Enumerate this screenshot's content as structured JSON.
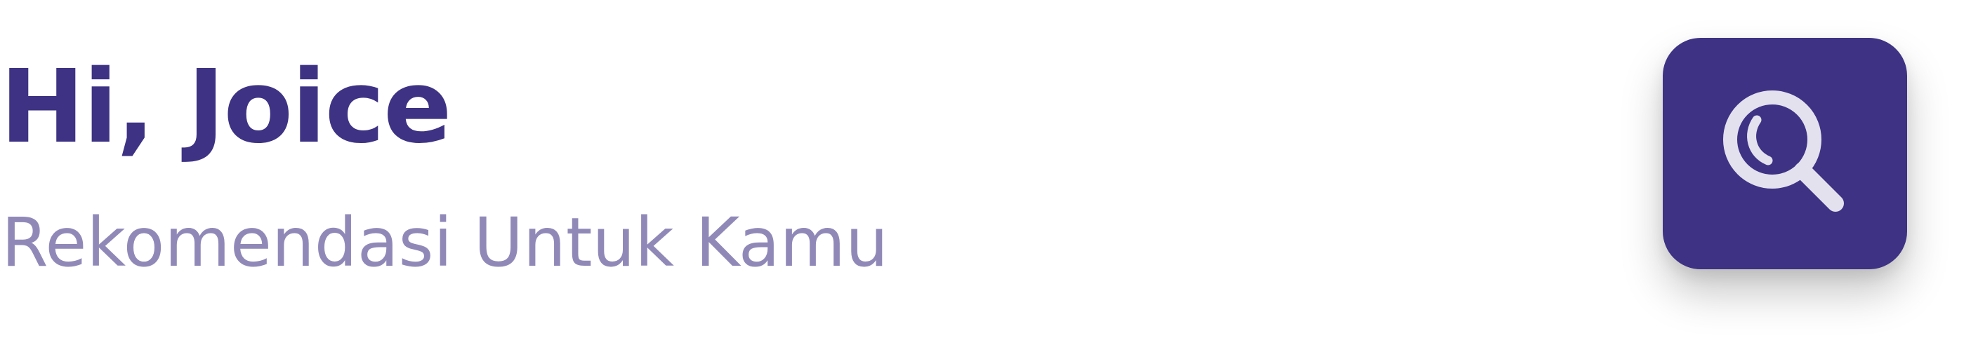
{
  "header": {
    "greeting": "Hi, Joice",
    "subtitle": "Rekomendasi Untuk Kamu"
  },
  "search_button": {
    "icon": "search-icon",
    "label": ""
  },
  "colors": {
    "primary": "#3d3283",
    "subtitle": "#9089b8",
    "icon": "#e4e1ef",
    "background": "#ffffff"
  }
}
